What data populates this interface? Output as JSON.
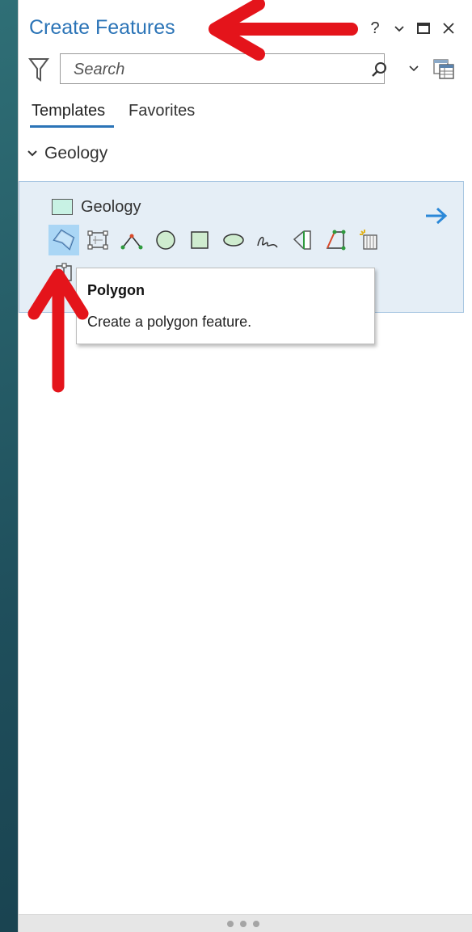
{
  "pane": {
    "title": "Create Features",
    "help_label": "?",
    "search_placeholder": "Search"
  },
  "tabs": [
    {
      "label": "Templates",
      "active": true
    },
    {
      "label": "Favorites",
      "active": false
    }
  ],
  "group": {
    "label": "Geology",
    "expanded": true
  },
  "template": {
    "name": "Geology",
    "swatch_color": "#c8f2e4",
    "tools": [
      {
        "icon": "polygon-tool-icon",
        "selected": true
      },
      {
        "icon": "rectangle-tool-icon"
      },
      {
        "icon": "triangle-tool-icon"
      },
      {
        "icon": "circle-tool-icon"
      },
      {
        "icon": "square-tool-icon"
      },
      {
        "icon": "ellipse-tool-icon"
      },
      {
        "icon": "freehand-tool-icon"
      },
      {
        "icon": "autocomplete-polygon-icon"
      },
      {
        "icon": "right-angle-polygon-icon"
      },
      {
        "icon": "trace-polygon-icon"
      },
      {
        "icon": "split-polygon-icon"
      }
    ]
  },
  "tooltip": {
    "title": "Polygon",
    "description": "Create a polygon feature."
  },
  "colors": {
    "accent": "#2b74b7",
    "annotation_arrow": "#e4141b",
    "selected_tool": "#aad6f5",
    "template_bg": "#e5eef6"
  }
}
